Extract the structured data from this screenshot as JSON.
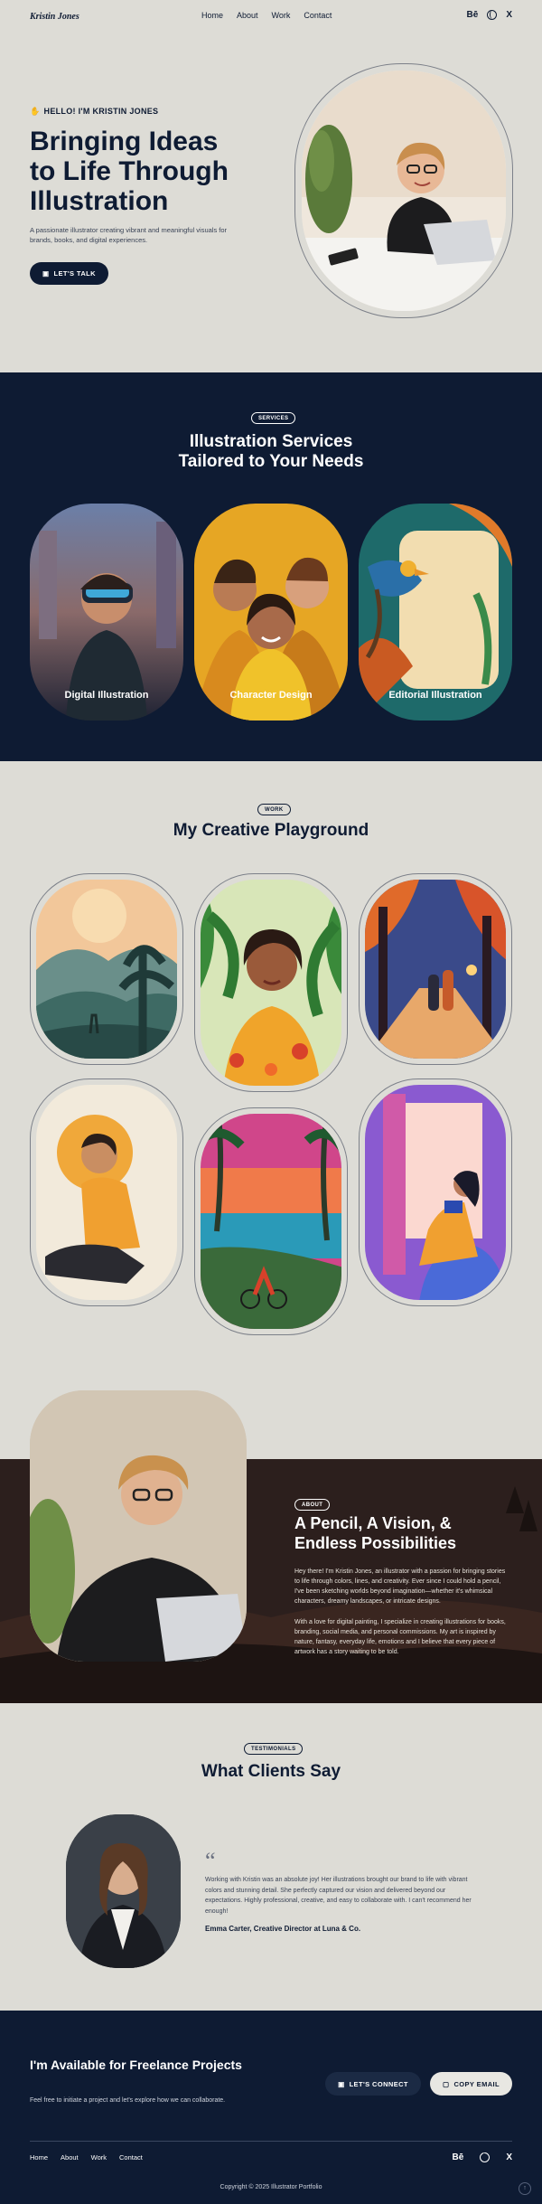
{
  "nav": {
    "logo": "Kristin Jones",
    "links": [
      "Home",
      "About",
      "Work",
      "Contact"
    ],
    "social": {
      "behance": "Bē",
      "twitter": "X"
    }
  },
  "hero": {
    "eyebrow": "HELLO! I'M KRISTIN JONES",
    "title_lines": [
      "Bringing Ideas",
      "to Life Through",
      "Illustration"
    ],
    "description": "A passionate illustrator creating vibrant and meaningful visuals for brands, books, and digital experiences.",
    "cta": "LET'S TALK"
  },
  "services": {
    "badge": "SERVICES",
    "title_lines": [
      "Illustration Services",
      "Tailored to Your Needs"
    ],
    "cards": [
      "Digital Illustration",
      "Character Design",
      "Editorial Illustration"
    ]
  },
  "work": {
    "badge": "WORK",
    "title": "My Creative Playground"
  },
  "about": {
    "badge": "ABOUT",
    "title_lines": [
      "A Pencil, A Vision, &",
      "Endless Possibilities"
    ],
    "p1": "Hey there! I'm Kristin Jones, an illustrator with a passion for bringing stories to life through colors, lines, and creativity. Ever since I could hold a pencil, I've been sketching worlds beyond imagination—whether it's whimsical characters, dreamy landscapes, or intricate designs.",
    "p2": "With a love for digital painting, I specialize in creating illustrations for books, branding, social media, and personal commissions. My art is inspired by nature, fantasy, everyday life, emotions and I believe that every piece of artwork has a story waiting to be told."
  },
  "testimonials": {
    "badge": "TESTIMONIALS",
    "title": "What Clients Say",
    "quote": "Working with Kristin was an absolute joy! Her illustrations brought our brand to life with vibrant colors and stunning detail. She perfectly captured our vision and delivered beyond our expectations. Highly professional, creative, and easy to collaborate with. I can't recommend her enough!",
    "author": "Emma Carter, Creative Director at Luna & Co."
  },
  "footer": {
    "title": "I'm Available for Freelance Projects",
    "subtitle": "Feel free to initiate a project and let's explore how we can collaborate.",
    "btn_connect": "LET'S CONNECT",
    "btn_email": "COPY EMAIL",
    "links": [
      "Home",
      "About",
      "Work",
      "Contact"
    ],
    "copyright": "Copyright © 2025 Illustrator Portfolio"
  },
  "colors": {
    "navy": "#0e1b33",
    "background": "#dddcd6",
    "accent": "#e7b33b"
  }
}
